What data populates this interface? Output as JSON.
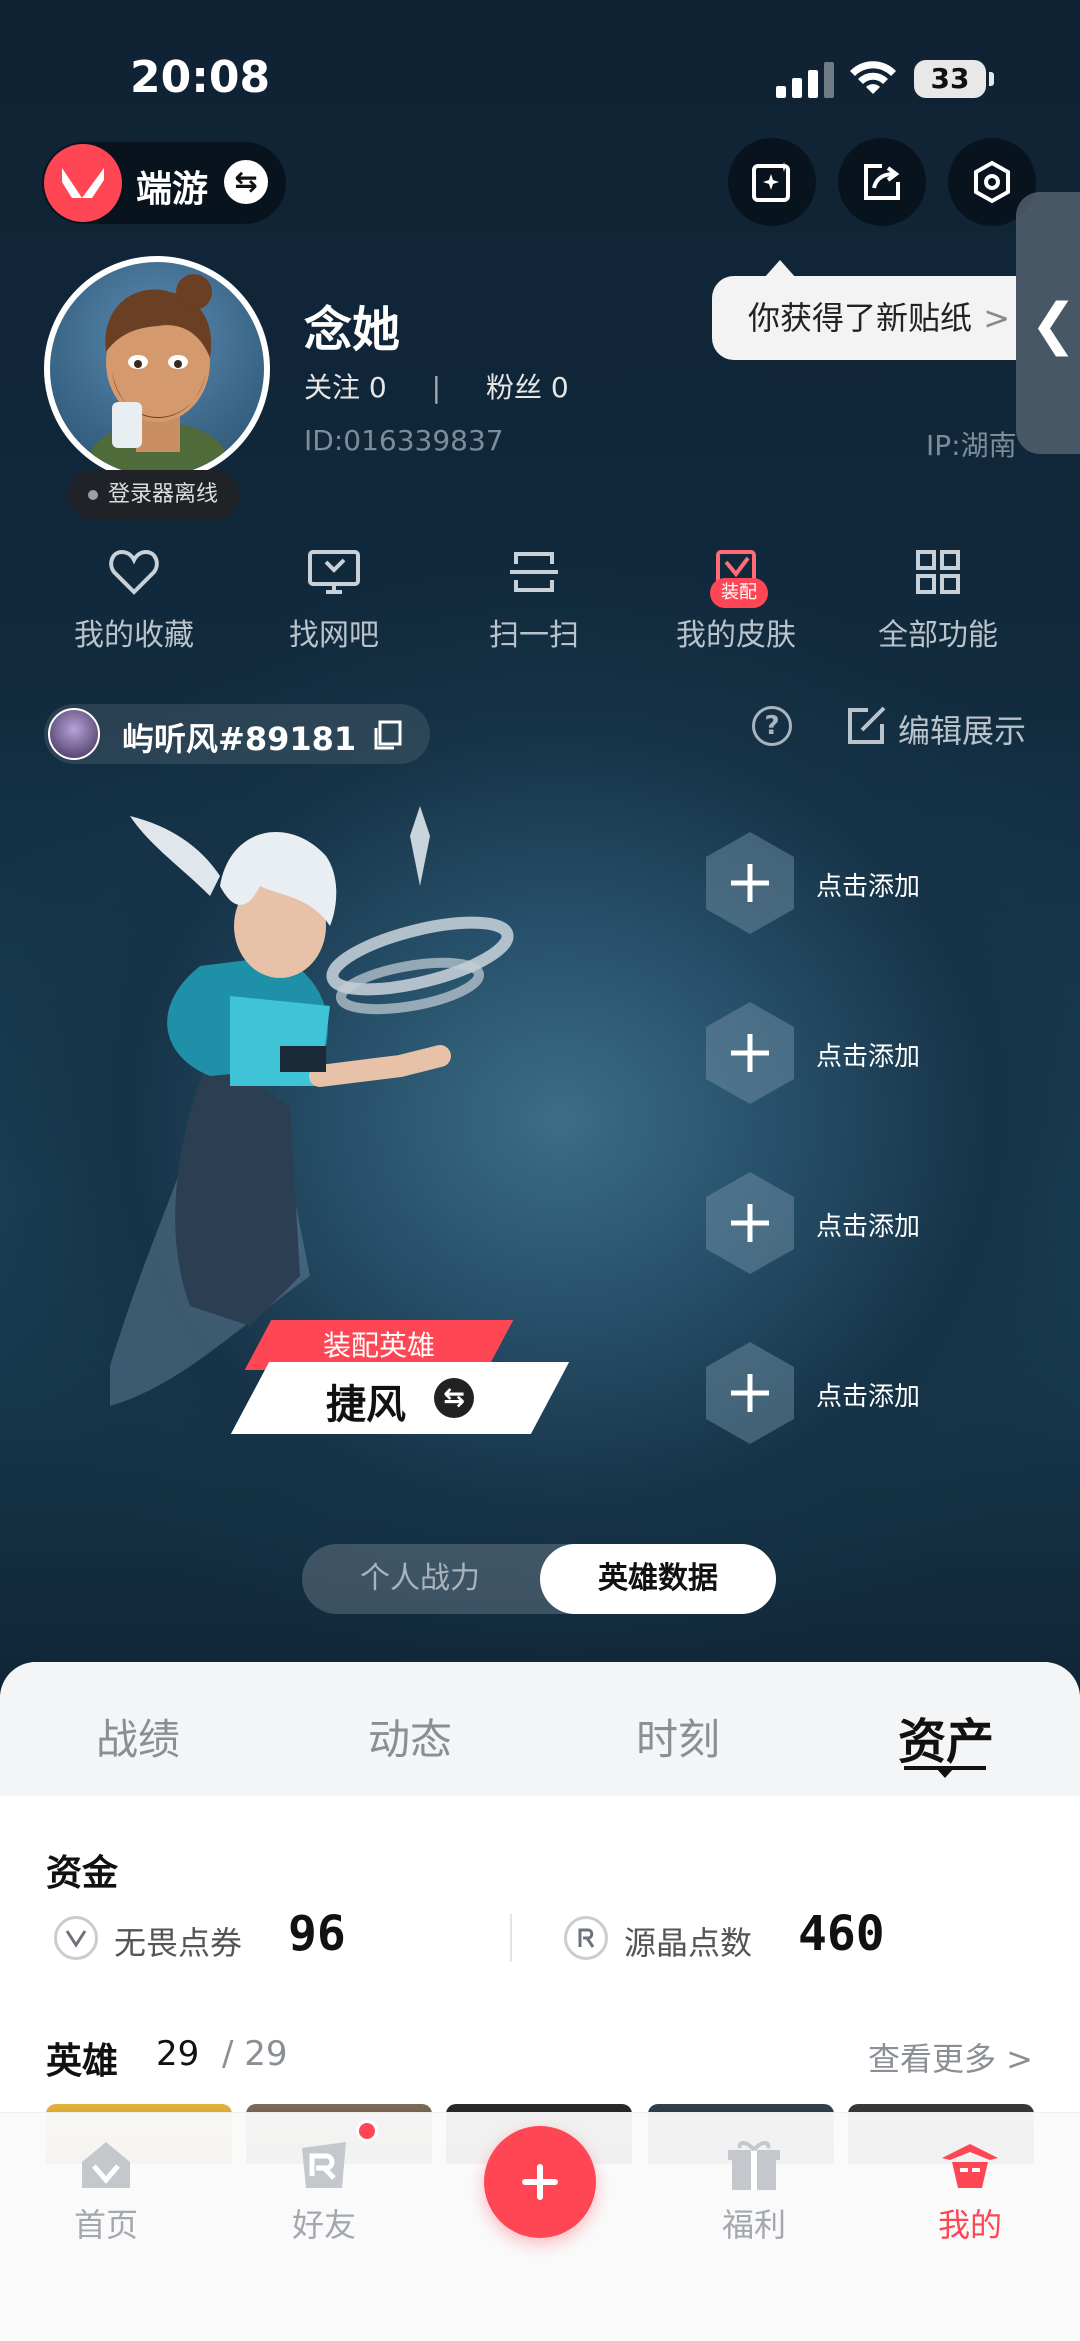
{
  "status_bar": {
    "time": "20:08",
    "battery": "33"
  },
  "header": {
    "game_name": "端游",
    "sticker_tip": "你获得了新贴纸",
    "sticker_tip_chevron": ">"
  },
  "profile": {
    "nickname": "念她",
    "follow_label": "关注",
    "follow_count": "0",
    "separator": "|",
    "fans_label": "粉丝",
    "fans_count": "0",
    "id_text": "ID:016339837",
    "ip_text": "IP:湖南",
    "online_status": "登录器离线"
  },
  "quick_actions": [
    {
      "label": "我的收藏",
      "icon": "heart-icon"
    },
    {
      "label": "找网吧",
      "icon": "monitor-icon"
    },
    {
      "label": "扫一扫",
      "icon": "scan-icon"
    },
    {
      "label": "我的皮肤",
      "icon": "skin-icon",
      "badge": "装配"
    },
    {
      "label": "全部功能",
      "icon": "grid-icon"
    }
  ],
  "riot": {
    "name": "屿听风#89181",
    "help": "?",
    "edit_label": "编辑展示"
  },
  "agent": {
    "tag": "装配英雄",
    "name": "捷风"
  },
  "slots": [
    {
      "label": "点击添加"
    },
    {
      "label": "点击添加"
    },
    {
      "label": "点击添加"
    },
    {
      "label": "点击添加"
    }
  ],
  "toggle": {
    "left": "个人战力",
    "right": "英雄数据",
    "selected": "英雄数据"
  },
  "tabs": [
    {
      "label": "战绩"
    },
    {
      "label": "动态"
    },
    {
      "label": "时刻"
    },
    {
      "label": "资产",
      "active": true
    }
  ],
  "funds": {
    "title": "资金",
    "items": [
      {
        "label": "无畏点券",
        "value": "96",
        "icon": "valorant-point-icon"
      },
      {
        "label": "源晶点数",
        "value": "460",
        "icon": "radianite-icon"
      }
    ]
  },
  "heroes": {
    "title": "英雄",
    "owned": "29",
    "total": "/ 29",
    "see_more": "查看更多 >"
  },
  "tabbar": [
    {
      "label": "首页",
      "icon": "home-icon"
    },
    {
      "label": "好友",
      "icon": "friends-icon",
      "dot": true
    },
    {
      "label": "",
      "icon": "plus-icon"
    },
    {
      "label": "福利",
      "icon": "gift-icon"
    },
    {
      "label": "我的",
      "icon": "me-icon",
      "active": true
    }
  ],
  "colors": {
    "accent": "#ff4655",
    "bg_dark": "#0f2536"
  }
}
